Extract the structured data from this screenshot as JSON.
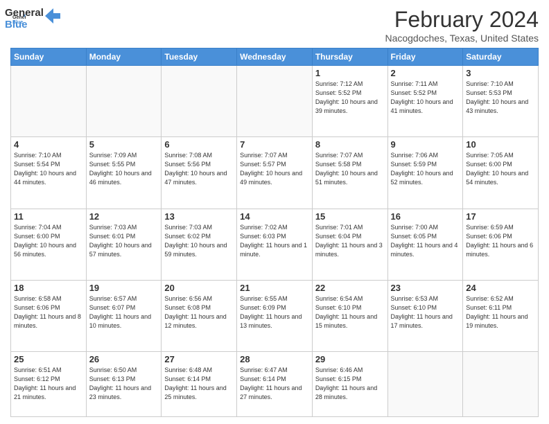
{
  "logo": {
    "text1": "General",
    "text2": "Blue"
  },
  "header": {
    "month": "February 2024",
    "location": "Nacogdoches, Texas, United States"
  },
  "days_of_week": [
    "Sunday",
    "Monday",
    "Tuesday",
    "Wednesday",
    "Thursday",
    "Friday",
    "Saturday"
  ],
  "weeks": [
    [
      {
        "day": "",
        "info": ""
      },
      {
        "day": "",
        "info": ""
      },
      {
        "day": "",
        "info": ""
      },
      {
        "day": "",
        "info": ""
      },
      {
        "day": "1",
        "info": "Sunrise: 7:12 AM\nSunset: 5:52 PM\nDaylight: 10 hours\nand 39 minutes."
      },
      {
        "day": "2",
        "info": "Sunrise: 7:11 AM\nSunset: 5:52 PM\nDaylight: 10 hours\nand 41 minutes."
      },
      {
        "day": "3",
        "info": "Sunrise: 7:10 AM\nSunset: 5:53 PM\nDaylight: 10 hours\nand 43 minutes."
      }
    ],
    [
      {
        "day": "4",
        "info": "Sunrise: 7:10 AM\nSunset: 5:54 PM\nDaylight: 10 hours\nand 44 minutes."
      },
      {
        "day": "5",
        "info": "Sunrise: 7:09 AM\nSunset: 5:55 PM\nDaylight: 10 hours\nand 46 minutes."
      },
      {
        "day": "6",
        "info": "Sunrise: 7:08 AM\nSunset: 5:56 PM\nDaylight: 10 hours\nand 47 minutes."
      },
      {
        "day": "7",
        "info": "Sunrise: 7:07 AM\nSunset: 5:57 PM\nDaylight: 10 hours\nand 49 minutes."
      },
      {
        "day": "8",
        "info": "Sunrise: 7:07 AM\nSunset: 5:58 PM\nDaylight: 10 hours\nand 51 minutes."
      },
      {
        "day": "9",
        "info": "Sunrise: 7:06 AM\nSunset: 5:59 PM\nDaylight: 10 hours\nand 52 minutes."
      },
      {
        "day": "10",
        "info": "Sunrise: 7:05 AM\nSunset: 6:00 PM\nDaylight: 10 hours\nand 54 minutes."
      }
    ],
    [
      {
        "day": "11",
        "info": "Sunrise: 7:04 AM\nSunset: 6:00 PM\nDaylight: 10 hours\nand 56 minutes."
      },
      {
        "day": "12",
        "info": "Sunrise: 7:03 AM\nSunset: 6:01 PM\nDaylight: 10 hours\nand 57 minutes."
      },
      {
        "day": "13",
        "info": "Sunrise: 7:03 AM\nSunset: 6:02 PM\nDaylight: 10 hours\nand 59 minutes."
      },
      {
        "day": "14",
        "info": "Sunrise: 7:02 AM\nSunset: 6:03 PM\nDaylight: 11 hours\nand 1 minute."
      },
      {
        "day": "15",
        "info": "Sunrise: 7:01 AM\nSunset: 6:04 PM\nDaylight: 11 hours\nand 3 minutes."
      },
      {
        "day": "16",
        "info": "Sunrise: 7:00 AM\nSunset: 6:05 PM\nDaylight: 11 hours\nand 4 minutes."
      },
      {
        "day": "17",
        "info": "Sunrise: 6:59 AM\nSunset: 6:06 PM\nDaylight: 11 hours\nand 6 minutes."
      }
    ],
    [
      {
        "day": "18",
        "info": "Sunrise: 6:58 AM\nSunset: 6:06 PM\nDaylight: 11 hours\nand 8 minutes."
      },
      {
        "day": "19",
        "info": "Sunrise: 6:57 AM\nSunset: 6:07 PM\nDaylight: 11 hours\nand 10 minutes."
      },
      {
        "day": "20",
        "info": "Sunrise: 6:56 AM\nSunset: 6:08 PM\nDaylight: 11 hours\nand 12 minutes."
      },
      {
        "day": "21",
        "info": "Sunrise: 6:55 AM\nSunset: 6:09 PM\nDaylight: 11 hours\nand 13 minutes."
      },
      {
        "day": "22",
        "info": "Sunrise: 6:54 AM\nSunset: 6:10 PM\nDaylight: 11 hours\nand 15 minutes."
      },
      {
        "day": "23",
        "info": "Sunrise: 6:53 AM\nSunset: 6:10 PM\nDaylight: 11 hours\nand 17 minutes."
      },
      {
        "day": "24",
        "info": "Sunrise: 6:52 AM\nSunset: 6:11 PM\nDaylight: 11 hours\nand 19 minutes."
      }
    ],
    [
      {
        "day": "25",
        "info": "Sunrise: 6:51 AM\nSunset: 6:12 PM\nDaylight: 11 hours\nand 21 minutes."
      },
      {
        "day": "26",
        "info": "Sunrise: 6:50 AM\nSunset: 6:13 PM\nDaylight: 11 hours\nand 23 minutes."
      },
      {
        "day": "27",
        "info": "Sunrise: 6:48 AM\nSunset: 6:14 PM\nDaylight: 11 hours\nand 25 minutes."
      },
      {
        "day": "28",
        "info": "Sunrise: 6:47 AM\nSunset: 6:14 PM\nDaylight: 11 hours\nand 27 minutes."
      },
      {
        "day": "29",
        "info": "Sunrise: 6:46 AM\nSunset: 6:15 PM\nDaylight: 11 hours\nand 28 minutes."
      },
      {
        "day": "",
        "info": ""
      },
      {
        "day": "",
        "info": ""
      }
    ]
  ]
}
